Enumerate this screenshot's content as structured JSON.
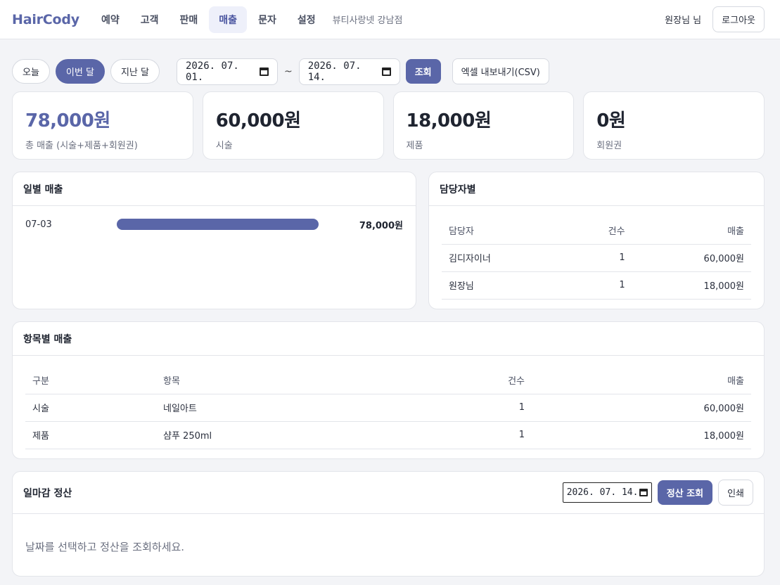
{
  "app": {
    "brand": "HairCody",
    "nav": [
      "예약",
      "고객",
      "판매",
      "매출",
      "문자",
      "설정"
    ],
    "store_name": "뷰티사랑넷 강남점",
    "user_label": "원장님 님",
    "logout_label": "로그아웃"
  },
  "filters": {
    "today": "오늘",
    "this_month": "이번 달",
    "last_month": "지난 달",
    "start_date": "2026. 07. 01.",
    "tilde": "~",
    "end_date": "2026. 07. 14.",
    "search_label": "조회",
    "export_label": "엑셀 내보내기(CSV)"
  },
  "stats": [
    {
      "value": "78,000원",
      "label": "총 매출 (시술+제품+회원권)"
    },
    {
      "value": "60,000원",
      "label": "시술"
    },
    {
      "value": "18,000원",
      "label": "제품"
    },
    {
      "value": "0원",
      "label": "회원권"
    }
  ],
  "daily": {
    "title": "일별 매출",
    "rows": [
      {
        "date": "07-03",
        "amount": "78,000원",
        "ratio": 1.0
      }
    ]
  },
  "staff": {
    "title": "담당자별",
    "headers": [
      "담당자",
      "건수",
      "매출"
    ],
    "rows": [
      [
        "김디자이너",
        "1",
        "60,000원"
      ],
      [
        "원장님",
        "1",
        "18,000원"
      ]
    ]
  },
  "items": {
    "title": "항목별 매출",
    "headers": [
      "구분",
      "항목",
      "건수",
      "매출"
    ],
    "rows": [
      [
        "시술",
        "네일아트",
        "1",
        "60,000원"
      ],
      [
        "제품",
        "샴푸 250ml",
        "1",
        "18,000원"
      ]
    ]
  },
  "closing": {
    "title": "일마감 정산",
    "date": "2026. 07. 14.",
    "search_label": "정산 조회",
    "print_label": "인쇄",
    "message": "날짜를 선택하고 정산을 조회하세요."
  },
  "colors": {
    "accent": "#5a66a8",
    "background": "#f3f4f7"
  }
}
